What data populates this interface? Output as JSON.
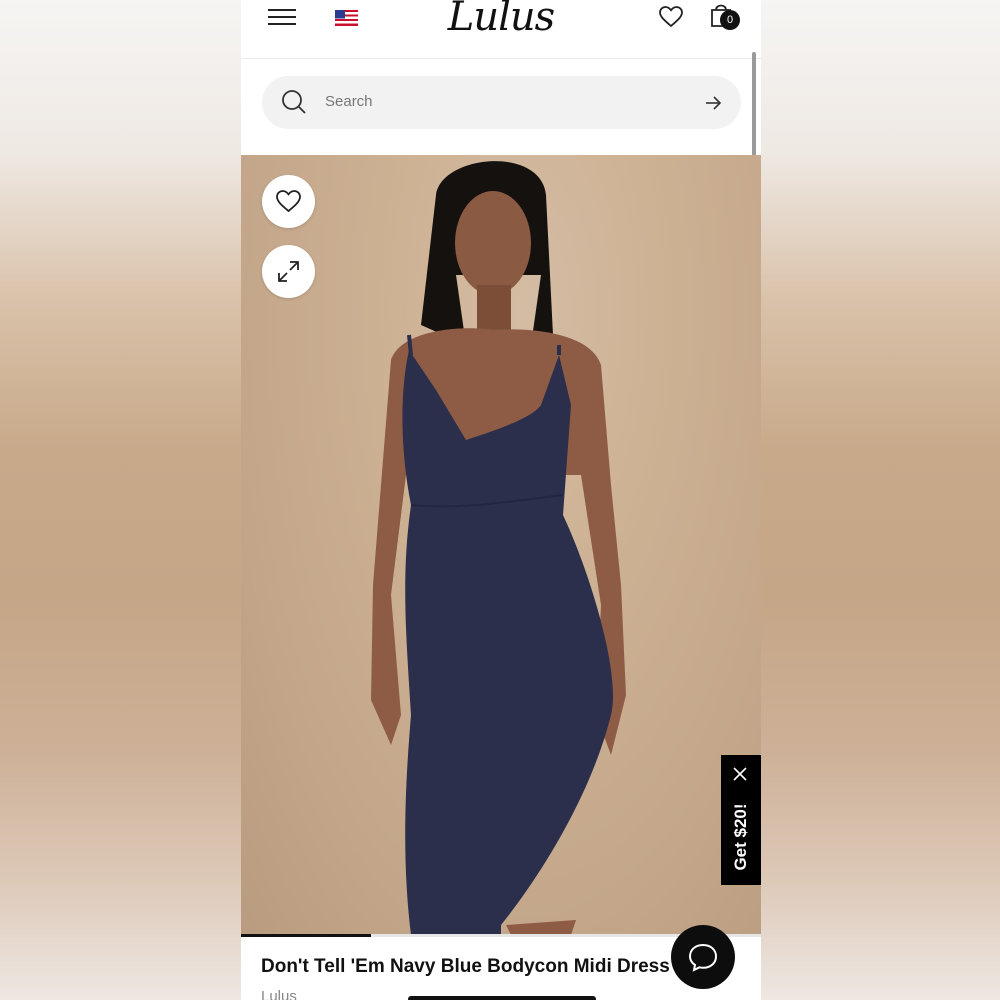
{
  "header": {
    "logo_text": "Lulus",
    "bag_count": "0"
  },
  "search": {
    "placeholder": "Search"
  },
  "gallery": {
    "progress": 0.25
  },
  "promo": {
    "label": "Get $20!"
  },
  "product": {
    "title": "Don't Tell 'Em Navy Blue Bodycon Midi Dress",
    "brand": "Lulus"
  },
  "colors": {
    "dress": "#2b2f4c",
    "accent": "#111111",
    "page_bg": "#c8a98a"
  },
  "icons": [
    "menu-icon",
    "flag-icon",
    "heart-icon",
    "bag-icon",
    "search-icon",
    "arrow-right-icon",
    "expand-icon",
    "close-icon",
    "chat-icon"
  ]
}
